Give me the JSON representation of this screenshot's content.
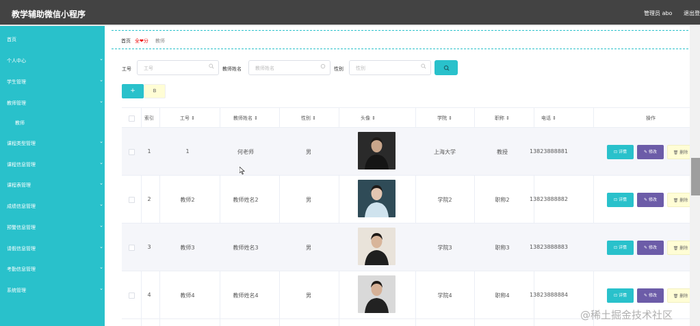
{
  "app": {
    "title": "教学辅助微信小程序",
    "admin": "管理员 abo",
    "logout": "退出登"
  },
  "sidebar": {
    "items": [
      {
        "label": "首页",
        "has_chevron": false
      },
      {
        "label": "个人中心",
        "has_chevron": true
      },
      {
        "label": "学生管理",
        "has_chevron": true
      },
      {
        "label": "教师管理",
        "has_chevron": true
      },
      {
        "label": "教师",
        "has_chevron": false,
        "sub": true
      },
      {
        "label": "课程类型管理",
        "has_chevron": true
      },
      {
        "label": "课程信息管理",
        "has_chevron": true
      },
      {
        "label": "课程表管理",
        "has_chevron": true
      },
      {
        "label": "成绩信息管理",
        "has_chevron": true
      },
      {
        "label": "预警信息管理",
        "has_chevron": true
      },
      {
        "label": "请假信息管理",
        "has_chevron": true
      },
      {
        "label": "考勤信息管理",
        "has_chevron": true
      },
      {
        "label": "系统管理",
        "has_chevron": true
      }
    ]
  },
  "breadcrumb": {
    "home": "首页",
    "sep": "全❤分",
    "current": "教师"
  },
  "search": {
    "job_no_label": "工号",
    "job_no_placeholder": "工号",
    "name_label": "教师姓名",
    "name_placeholder": "教师姓名",
    "gender_label": "性别",
    "gender_placeholder": "性别"
  },
  "toolbar": {
    "add": "+",
    "delete": "B"
  },
  "table": {
    "headers": [
      "索引",
      "工号 ⇕",
      "教师姓名 ⇕",
      "性别 ⇕",
      "头像 ⇕",
      "学院 ⇕",
      "职称 ⇕",
      "电话 ⇕",
      "操作"
    ],
    "rows": [
      {
        "index": "1",
        "job_no": "1",
        "name": "何老师",
        "gender": "男",
        "college": "上海大学",
        "title": "教授",
        "phone": "13823888881"
      },
      {
        "index": "2",
        "job_no": "教师2",
        "name": "教师姓名2",
        "gender": "男",
        "college": "学院2",
        "title": "职称2",
        "phone": "13823888882"
      },
      {
        "index": "3",
        "job_no": "教师3",
        "name": "教师姓名3",
        "gender": "男",
        "college": "学院3",
        "title": "职称3",
        "phone": "13823888883"
      },
      {
        "index": "4",
        "job_no": "教师4",
        "name": "教师姓名4",
        "gender": "男",
        "college": "学院4",
        "title": "职称4",
        "phone": "13823888884"
      }
    ],
    "ops": {
      "detail": "⊡ 详情",
      "edit": "✎ 修改",
      "delete": "🗑 删除"
    }
  },
  "watermark": "@稀土掘金技术社区",
  "colors": {
    "accent": "#29c1cb",
    "topbar": "#434343",
    "edit": "#6c5ca8",
    "delete_bg": "#fffdd5"
  }
}
